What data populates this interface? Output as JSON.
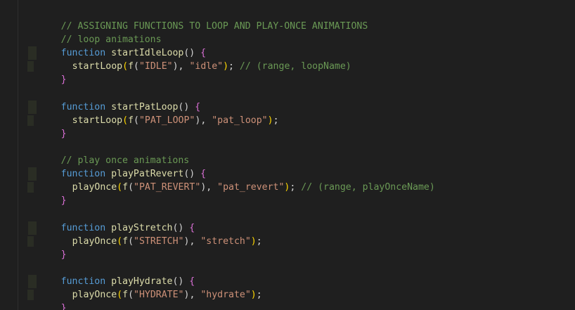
{
  "colors": {
    "background": "#1f1f1f",
    "comment": "#6a9955",
    "keyword": "#569cd6",
    "function": "#dcdcaa",
    "string": "#ce9178",
    "brace": "#da70d6",
    "paren": "#ffd700",
    "text": "#d4d4d4"
  },
  "code": {
    "header_comment": "// ASSIGNING FUNCTIONS TO LOOP AND PLAY-ONCE ANIMATIONS",
    "loop_comment": "// loop animations",
    "play_once_comment": "// play once animations",
    "keyword": "function",
    "blocks": [
      {
        "name": "startIdleLoop",
        "call": "startLoop",
        "range": "\"IDLE\"",
        "label": "\"idle\"",
        "trailing_comment": "// (range, loopName)"
      },
      {
        "name": "startPatLoop",
        "call": "startLoop",
        "range": "\"PAT_LOOP\"",
        "label": "\"pat_loop\"",
        "trailing_comment": ""
      },
      {
        "name": "playPatRevert",
        "call": "playOnce",
        "range": "\"PAT_REVERT\"",
        "label": "\"pat_revert\"",
        "trailing_comment": "// (range, playOnceName)"
      },
      {
        "name": "playStretch",
        "call": "playOnce",
        "range": "\"STRETCH\"",
        "label": "\"stretch\"",
        "trailing_comment": ""
      },
      {
        "name": "playHydrate",
        "call": "playOnce",
        "range": "\"HYDRATE\"",
        "label": "\"hydrate\"",
        "trailing_comment": ""
      }
    ]
  }
}
